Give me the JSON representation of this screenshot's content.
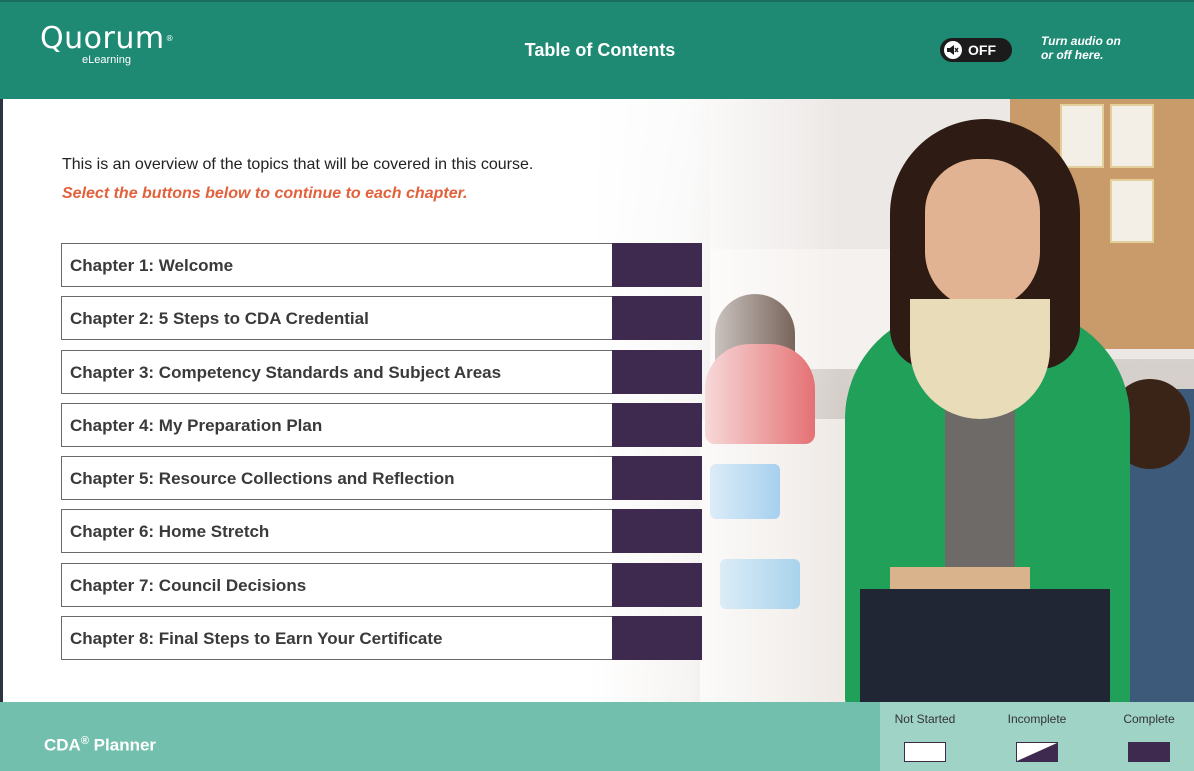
{
  "header": {
    "logo_text": "Quorum",
    "logo_sub": "eLearning",
    "title": "Table of Contents",
    "audio_state": "OFF",
    "audio_hint_line1": "Turn audio on",
    "audio_hint_line2": "or off here."
  },
  "intro": {
    "text": "This is an overview of the topics that will be covered in this course.",
    "instruction": "Select the buttons below to continue to each chapter."
  },
  "chapters": [
    {
      "label": "Chapter 1: Welcome",
      "status": "complete"
    },
    {
      "label": "Chapter 2: 5 Steps to CDA Credential",
      "status": "complete"
    },
    {
      "label": "Chapter 3: Competency Standards and Subject Areas",
      "status": "complete"
    },
    {
      "label": "Chapter 4: My Preparation Plan",
      "status": "complete"
    },
    {
      "label": "Chapter 5: Resource Collections and Reflection",
      "status": "complete"
    },
    {
      "label": "Chapter 6: Home Stretch",
      "status": "complete"
    },
    {
      "label": "Chapter 7: Council Decisions",
      "status": "complete"
    },
    {
      "label": "Chapter 8: Final Steps to Earn Your Certificate",
      "status": "complete"
    }
  ],
  "footer": {
    "title": "CDA",
    "title_sup": "®",
    "title_rest": " Planner"
  },
  "legend": {
    "not_started": "Not Started",
    "incomplete": "Incomplete",
    "complete": "Complete"
  },
  "colors": {
    "header": "#1e8a74",
    "footer": "#72bfae",
    "status_complete": "#3f2a4f",
    "instruction": "#e2603b"
  }
}
